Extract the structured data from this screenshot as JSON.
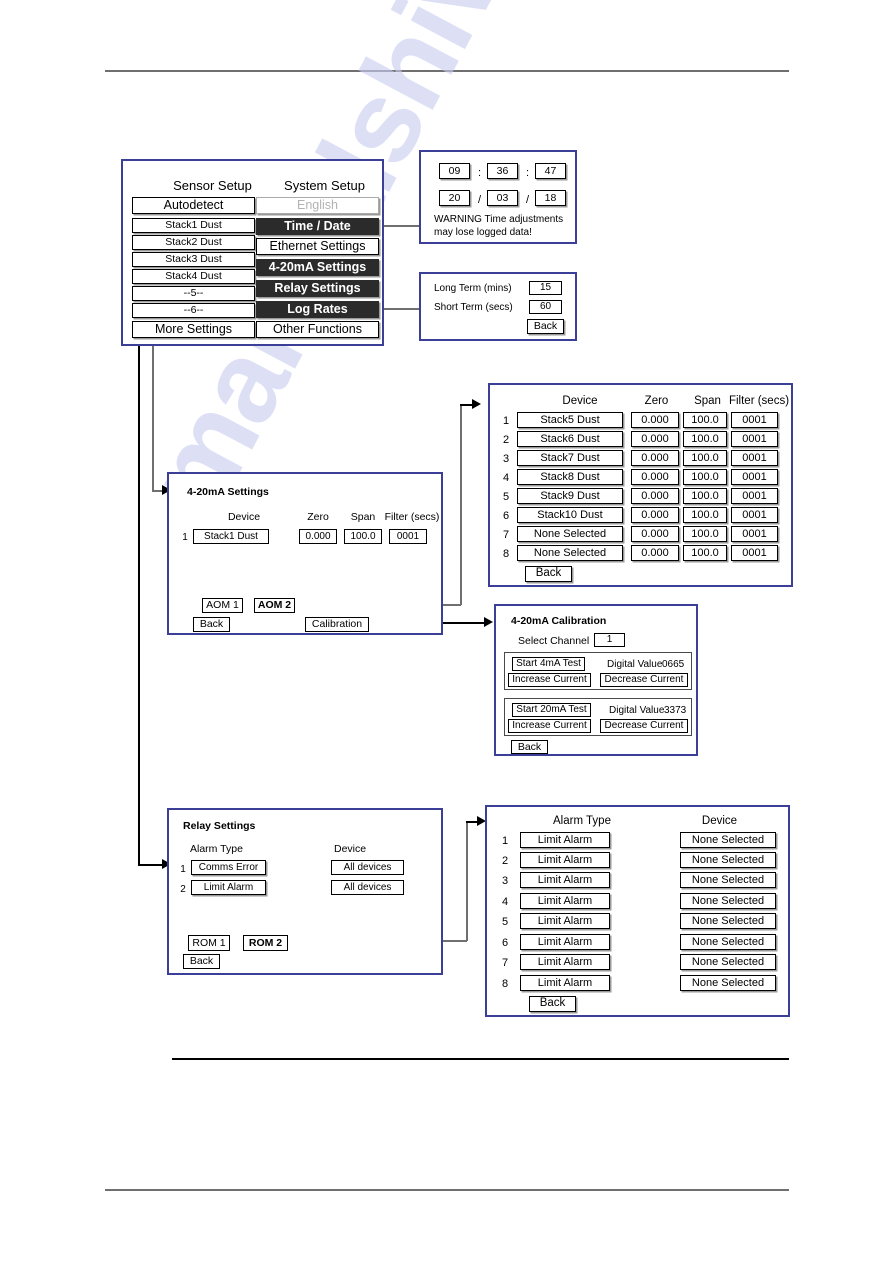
{
  "watermark": {
    "text": "manualshive.com"
  },
  "main_menu": {
    "col1_header": "Sensor Setup",
    "col2_header": "System Setup",
    "sensor_items": [
      {
        "label": "Autodetect",
        "style": "big"
      },
      {
        "label": "Stack1 Dust",
        "style": "small"
      },
      {
        "label": "Stack2 Dust",
        "style": "small"
      },
      {
        "label": "Stack3 Dust",
        "style": "small"
      },
      {
        "label": "Stack4 Dust",
        "style": "small"
      },
      {
        "label": "--5--",
        "style": "small"
      },
      {
        "label": "--6--",
        "style": "small"
      },
      {
        "label": "More Settings",
        "style": "big"
      }
    ],
    "system_items": [
      {
        "label": "English",
        "state": "disabled"
      },
      {
        "label": "Time / Date",
        "state": "selected"
      },
      {
        "label": "Ethernet Settings",
        "state": "normal"
      },
      {
        "label": "4-20mA Settings",
        "state": "selected"
      },
      {
        "label": "Relay Settings",
        "state": "selected"
      },
      {
        "label": "Log Rates",
        "state": "selected"
      },
      {
        "label": "Other Functions",
        "state": "normal"
      }
    ]
  },
  "time_date": {
    "hour": "09",
    "sep1": ":",
    "minute": "36",
    "sep2": ":",
    "second": "47",
    "day": "20",
    "dsep1": "/",
    "month": "03",
    "dsep2": "/",
    "year": "18",
    "warning_line1": "WARNING Time adjustments",
    "warning_line2": "may lose logged data!"
  },
  "log_rates": {
    "long_term_label": "Long Term (mins)",
    "long_term_value": "15",
    "short_term_label": "Short Term (secs)",
    "short_term_value": "60",
    "back_label": "Back"
  },
  "aom_settings": {
    "title": "4-20mA Settings",
    "headers": {
      "device": "Device",
      "zero": "Zero",
      "span": "Span",
      "filter": "Filter (secs)"
    },
    "rows": [
      {
        "n": "1",
        "device": "Stack1 Dust",
        "zero": "0.000",
        "span": "100.0",
        "filter": "0001"
      }
    ],
    "aom1_label": "AOM 1",
    "aom2_label": "AOM 2",
    "back_label": "Back",
    "calibration_label": "Calibration"
  },
  "aom_devices": {
    "headers": {
      "device": "Device",
      "zero": "Zero",
      "span": "Span",
      "filter": "Filter (secs)"
    },
    "rows": [
      {
        "n": "1",
        "device": "Stack5 Dust",
        "zero": "0.000",
        "span": "100.0",
        "filter": "0001"
      },
      {
        "n": "2",
        "device": "Stack6 Dust",
        "zero": "0.000",
        "span": "100.0",
        "filter": "0001"
      },
      {
        "n": "3",
        "device": "Stack7 Dust",
        "zero": "0.000",
        "span": "100.0",
        "filter": "0001"
      },
      {
        "n": "4",
        "device": "Stack8 Dust",
        "zero": "0.000",
        "span": "100.0",
        "filter": "0001"
      },
      {
        "n": "5",
        "device": "Stack9 Dust",
        "zero": "0.000",
        "span": "100.0",
        "filter": "0001"
      },
      {
        "n": "6",
        "device": "Stack10 Dust",
        "zero": "0.000",
        "span": "100.0",
        "filter": "0001"
      },
      {
        "n": "7",
        "device": "None Selected",
        "zero": "0.000",
        "span": "100.0",
        "filter": "0001"
      },
      {
        "n": "8",
        "device": "None Selected",
        "zero": "0.000",
        "span": "100.0",
        "filter": "0001"
      }
    ],
    "back_label": "Back"
  },
  "calibration": {
    "title": "4-20mA Calibration",
    "select_channel_label": "Select Channel",
    "select_channel_value": "1",
    "test4": {
      "start_label": "Start 4mA Test",
      "digital_label": "Digital Value",
      "digital_value": "0665",
      "increase_label": "Increase Current",
      "decrease_label": "Decrease Current"
    },
    "test20": {
      "start_label": "Start 20mA Test",
      "digital_label": "Digital Value",
      "digital_value": "3373",
      "increase_label": "Increase Current",
      "decrease_label": "Decrease Current"
    },
    "back_label": "Back"
  },
  "relay_settings": {
    "title": "Relay  Settings",
    "headers": {
      "alarm_type": "Alarm Type",
      "device": "Device"
    },
    "rows": [
      {
        "n": "1",
        "alarm_type": "Comms Error",
        "device": "All devices"
      },
      {
        "n": "2",
        "alarm_type": "Limit Alarm",
        "device": "All devices"
      }
    ],
    "rom1_label": "ROM 1",
    "rom2_label": "ROM 2",
    "back_label": "Back"
  },
  "alarm_table": {
    "headers": {
      "alarm_type": "Alarm Type",
      "device": "Device"
    },
    "rows": [
      {
        "n": "1",
        "alarm_type": "Limit Alarm",
        "device": "None Selected"
      },
      {
        "n": "2",
        "alarm_type": "Limit Alarm",
        "device": "None Selected"
      },
      {
        "n": "3",
        "alarm_type": "Limit Alarm",
        "device": "None Selected"
      },
      {
        "n": "4",
        "alarm_type": "Limit Alarm",
        "device": "None Selected"
      },
      {
        "n": "5",
        "alarm_type": "Limit Alarm",
        "device": "None Selected"
      },
      {
        "n": "6",
        "alarm_type": "Limit Alarm",
        "device": "None Selected"
      },
      {
        "n": "7",
        "alarm_type": "Limit Alarm",
        "device": "None Selected"
      },
      {
        "n": "8",
        "alarm_type": "Limit Alarm",
        "device": "None Selected"
      }
    ],
    "back_label": "Back"
  }
}
